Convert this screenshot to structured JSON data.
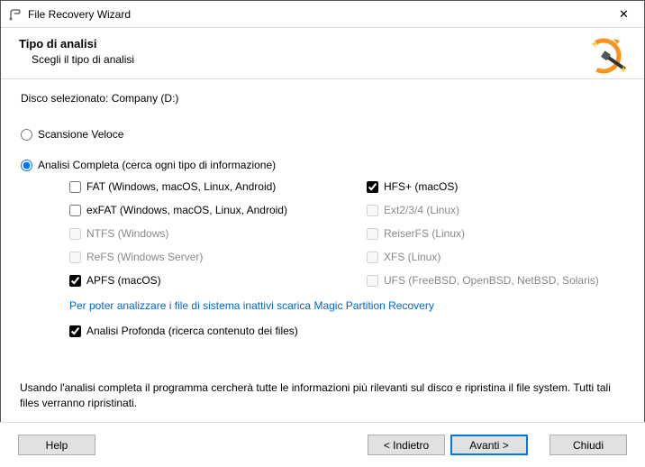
{
  "window": {
    "title": "File Recovery Wizard",
    "close_glyph": "✕"
  },
  "header": {
    "heading": "Tipo di analisi",
    "sub": "Scegli il tipo di analisi"
  },
  "disk": {
    "label": "Disco selezionato: Company (D:)"
  },
  "radios": {
    "fast": "Scansione Veloce",
    "full": "Analisi Completa (cerca ogni tipo di informazione)"
  },
  "fs": {
    "fat": {
      "label": "FAT (Windows, macOS, Linux, Android)",
      "checked": false,
      "disabled": false
    },
    "hfs": {
      "label": "HFS+ (macOS)",
      "checked": true,
      "disabled": false
    },
    "exfat": {
      "label": "exFAT (Windows, macOS, Linux, Android)",
      "checked": false,
      "disabled": false
    },
    "ext": {
      "label": "Ext2/3/4 (Linux)",
      "checked": false,
      "disabled": true
    },
    "ntfs": {
      "label": "NTFS (Windows)",
      "checked": false,
      "disabled": true
    },
    "reiser": {
      "label": "ReiserFS (Linux)",
      "checked": false,
      "disabled": true
    },
    "refs": {
      "label": "ReFS (Windows Server)",
      "checked": false,
      "disabled": true
    },
    "xfs": {
      "label": "XFS (Linux)",
      "checked": false,
      "disabled": true
    },
    "apfs": {
      "label": "APFS (macOS)",
      "checked": true,
      "disabled": false
    },
    "ufs": {
      "label": "UFS (FreeBSD, OpenBSD, NetBSD, Solaris)",
      "checked": false,
      "disabled": true
    }
  },
  "link": "Per poter analizzare i file di sistema inattivi scarica Magic Partition Recovery",
  "deep": {
    "label": "Analisi Profonda (ricerca contenuto dei files)",
    "checked": true
  },
  "footnote": "Usando l'analisi completa il programma cercherà tutte le informazioni più rilevanti sul disco e ripristina il file system. Tutti tali files verranno ripristinati.",
  "buttons": {
    "help": "Help",
    "back": "< Indietro",
    "next": "Avanti >",
    "close": "Chiudi"
  }
}
